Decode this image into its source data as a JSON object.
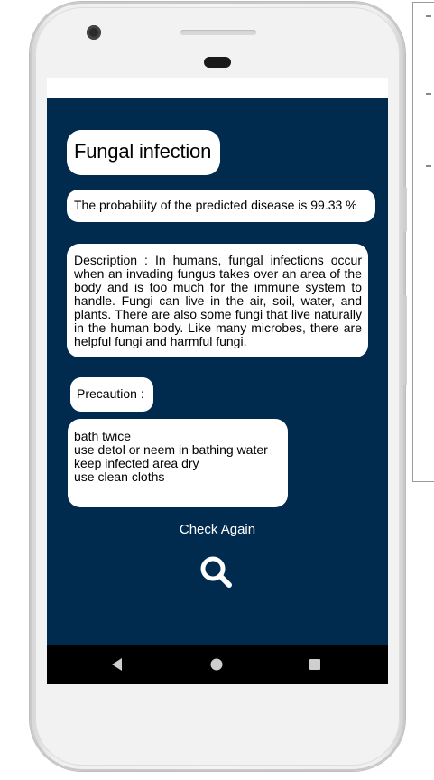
{
  "result": {
    "disease_name": "Fungal infection",
    "probability_text": "The probability of the predicted disease is 99.33 %",
    "description": "Description : In humans, fungal infections occur when an invading fungus takes over an area of the body and is too much for the immune system to handle. Fungi can live in the air, soil, water, and plants. There are also some fungi that live naturally in the human body. Like many microbes, there are helpful fungi and harmful fungi."
  },
  "precaution": {
    "label": "Precaution :",
    "items": [
      "bath twice",
      "use detol or neem in bathing water",
      "keep infected area dry",
      "use clean cloths"
    ]
  },
  "actions": {
    "check_again_label": "Check Again",
    "search_icon": "search-icon"
  },
  "navigation": {
    "back_icon": "back-triangle-icon",
    "home_icon": "home-circle-icon",
    "recents_icon": "recents-square-icon"
  },
  "colors": {
    "app_background": "#002a4e",
    "card_background": "#ffffff",
    "nav_bar": "#000000"
  }
}
